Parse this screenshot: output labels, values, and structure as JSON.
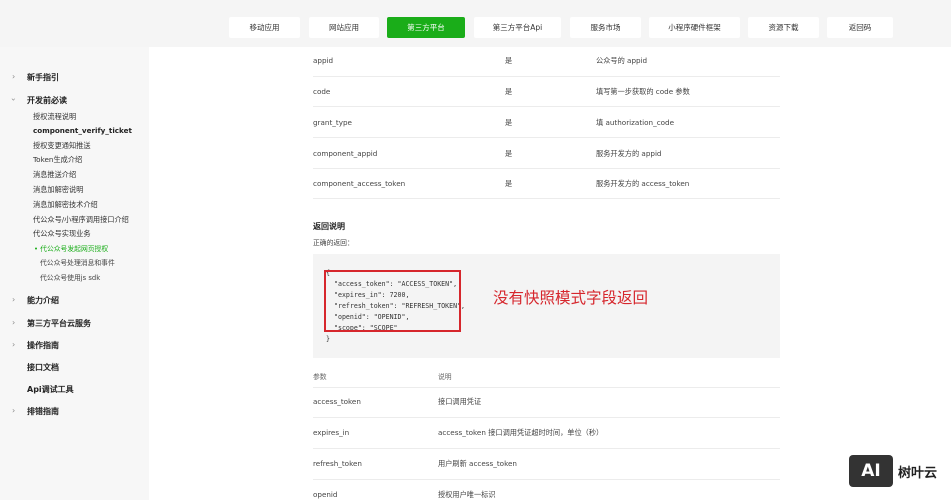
{
  "nav": {
    "tabs": [
      {
        "label": "移动应用",
        "active": false
      },
      {
        "label": "网站应用",
        "active": false
      },
      {
        "label": "第三方平台",
        "active": true
      },
      {
        "label": "第三方平台Api",
        "active": false
      },
      {
        "label": "服务市场",
        "active": false
      },
      {
        "label": "小程序硬件框架",
        "active": false
      },
      {
        "label": "资源下载",
        "active": false
      },
      {
        "label": "返回码",
        "active": false
      }
    ]
  },
  "sidebar": {
    "headings": [
      "新手指引",
      "开发前必读",
      "能力介绍",
      "第三方平台云服务",
      "操作指南",
      "接口文档",
      "Api调试工具",
      "排错指南"
    ],
    "items": [
      "授权流程说明",
      "component_verify_ticket",
      "授权变更通知推送",
      "Token生成介绍",
      "消息推送介绍",
      "消息加解密说明",
      "消息加解密技术介绍",
      "代公众号/小程序调用接口介绍",
      "代公众号实现业务"
    ],
    "subitems": [
      "代公众号发起网页授权",
      "代公众号处理消息和事件",
      "代公众号使用js sdk"
    ]
  },
  "params_table": [
    {
      "name": "appid",
      "required": "是",
      "desc": "公众号的 appid"
    },
    {
      "name": "code",
      "required": "是",
      "desc": "填写第一步获取的 code 参数"
    },
    {
      "name": "grant_type",
      "required": "是",
      "desc": "填 authorization_code"
    },
    {
      "name": "component_appid",
      "required": "是",
      "desc": "服务开发方的 appid"
    },
    {
      "name": "component_access_token",
      "required": "是",
      "desc": "服务开发方的 access_token"
    }
  ],
  "return_section": {
    "title": "返回说明",
    "subtitle": "正确的返回：",
    "code_open": "{",
    "code_lines": [
      "\"access_token\": \"ACCESS_TOKEN\",",
      "\"expires_in\": 7200,",
      "\"refresh_token\": \"REFRESH_TOKEN\",",
      "\"openid\": \"OPENID\",",
      "\"scope\": \"SCOPE\""
    ],
    "code_close": "}",
    "annotation": "没有快照模式字段返回"
  },
  "result_table": {
    "headers": [
      "参数",
      "说明"
    ],
    "rows": [
      {
        "name": "access_token",
        "desc": "接口调用凭证"
      },
      {
        "name": "expires_in",
        "desc": "access_token 接口调用凭证超时时间，单位（秒）"
      },
      {
        "name": "refresh_token",
        "desc": "用户刷新 access_token"
      },
      {
        "name": "openid",
        "desc": "授权用户唯一标识"
      }
    ]
  },
  "watermark": {
    "logo": "AI",
    "text": "树叶云"
  },
  "colors": {
    "accent": "#1aad19",
    "annotation": "#d6262c"
  }
}
